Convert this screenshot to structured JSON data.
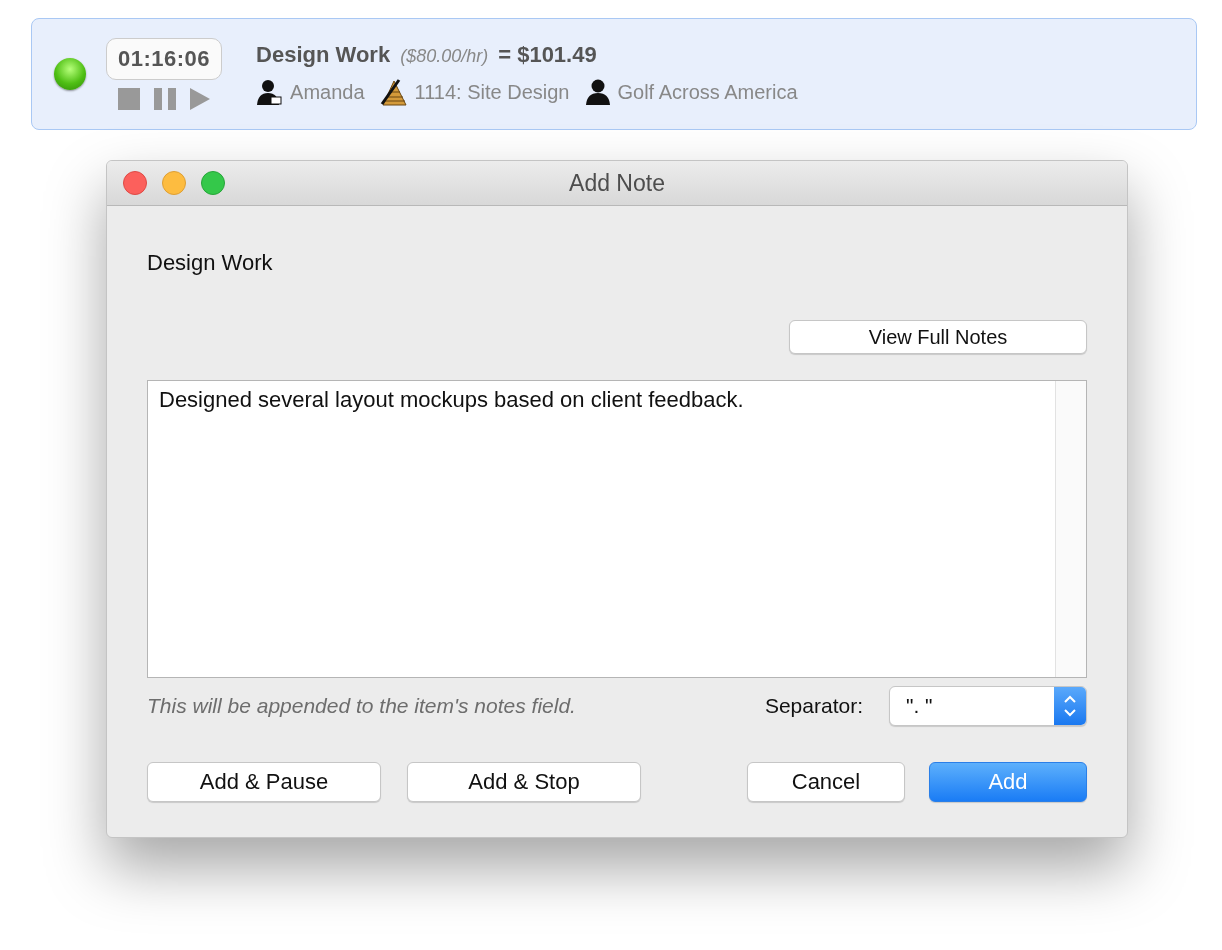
{
  "timer": {
    "elapsed": "01:16:06",
    "task": "Design Work",
    "rate": "($80.00/hr)",
    "total": "= $101.49",
    "details": [
      {
        "kind": "person",
        "label": "Amanda"
      },
      {
        "kind": "project",
        "label": "1114: Site Design"
      },
      {
        "kind": "client",
        "label": "Golf Across America"
      }
    ]
  },
  "window": {
    "title": "Add Note"
  },
  "item_title": "Design Work",
  "view_button": "View Full Notes",
  "note": {
    "value": "Designed several layout mockups based on client feedback."
  },
  "hint": "This will be appended to the item's notes field.",
  "separator": {
    "label": "Separator:",
    "value": "\". \""
  },
  "buttons": [
    {
      "label": "Add & Pause",
      "kind": "normal"
    },
    {
      "label": "Add & Stop",
      "kind": "normal"
    },
    {
      "label": "Cancel",
      "kind": "normal"
    },
    {
      "label": "Add",
      "kind": "default"
    }
  ]
}
